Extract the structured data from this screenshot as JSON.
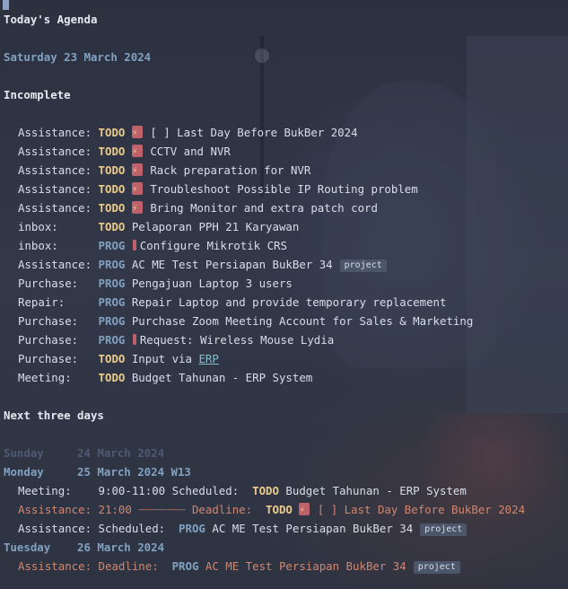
{
  "agenda": {
    "title": "Today's Agenda",
    "today_date": "Saturday 23 March 2024",
    "incomplete_header": "Incomplete",
    "incomplete": [
      {
        "category": "Assistance:",
        "state": "TODO",
        "priority": true,
        "text": "[ ] Last Day Before BukBer 2024"
      },
      {
        "category": "Assistance:",
        "state": "TODO",
        "priority": true,
        "text": "CCTV and NVR"
      },
      {
        "category": "Assistance:",
        "state": "TODO",
        "priority": true,
        "text": "Rack preparation for NVR"
      },
      {
        "category": "Assistance:",
        "state": "TODO",
        "priority": true,
        "text": "Troubleshoot Possible IP Routing problem"
      },
      {
        "category": "Assistance:",
        "state": "TODO",
        "priority": true,
        "text": "Bring Monitor and extra patch cord"
      },
      {
        "category": "inbox:",
        "state": "TODO",
        "text": "Pelaporan PPH 21 Karyawan"
      },
      {
        "category": "inbox:",
        "state": "PROG",
        "urgent": true,
        "text": "Configure Mikrotik CRS"
      },
      {
        "category": "Assistance:",
        "state": "PROG",
        "text": "AC ME Test Persiapan BukBer 34",
        "tag": "project"
      },
      {
        "category": "Purchase:",
        "state": "PROG",
        "text": "Pengajuan Laptop 3 users"
      },
      {
        "category": "Repair:",
        "state": "PROG",
        "text": "Repair Laptop and provide temporary replacement"
      },
      {
        "category": "Purchase:",
        "state": "PROG",
        "text": "Purchase Zoom Meeting Account for Sales & Marketing"
      },
      {
        "category": "Purchase:",
        "state": "PROG",
        "urgent": true,
        "text": "Request: Wireless Mouse Lydia"
      },
      {
        "category": "Purchase:",
        "state": "TODO",
        "text": "Input via ",
        "link": "ERP"
      },
      {
        "category": "Meeting:",
        "state": "TODO",
        "text": "Budget Tahunan - ERP System"
      }
    ],
    "next_header": "Next three days",
    "days": [
      {
        "label": "Sunday     24 March 2024",
        "dim": true,
        "entries": []
      },
      {
        "label": "Monday     25 March 2024 W13",
        "entries": [
          {
            "category": "Meeting:",
            "time": "    9:00-11:00 Scheduled:",
            "state": "TODO",
            "text": "Budget Tahunan - ERP System"
          },
          {
            "category": "Assistance:",
            "time": " 21:00 ┈┈┈┈┈┈┈ Deadline:",
            "state": "TODO",
            "priority": true,
            "text": "[ ] Last Day Before BukBer 2024",
            "warn": true
          },
          {
            "category": "Assistance:",
            "time": " Scheduled:",
            "state": "PROG",
            "text": "AC ME Test Persiapan BukBer 34",
            "tag": "project"
          }
        ]
      },
      {
        "label": "Tuesday    26 March 2024",
        "entries": [
          {
            "category": "Assistance:",
            "time": " Deadline:",
            "state": "PROG",
            "text": "AC ME Test Persiapan BukBer 34",
            "tag": "project",
            "warn": true
          }
        ]
      }
    ]
  },
  "colors": {
    "background": "#2f3442",
    "todo": "#ebcb8b",
    "prog": "#81a1c1",
    "date": "#81a1c1",
    "deadline": "#d08770",
    "urgent": "#bf616a"
  },
  "icons": {
    "priority": "lightning-bolt-icon",
    "urgent": "exclamation-icon"
  }
}
